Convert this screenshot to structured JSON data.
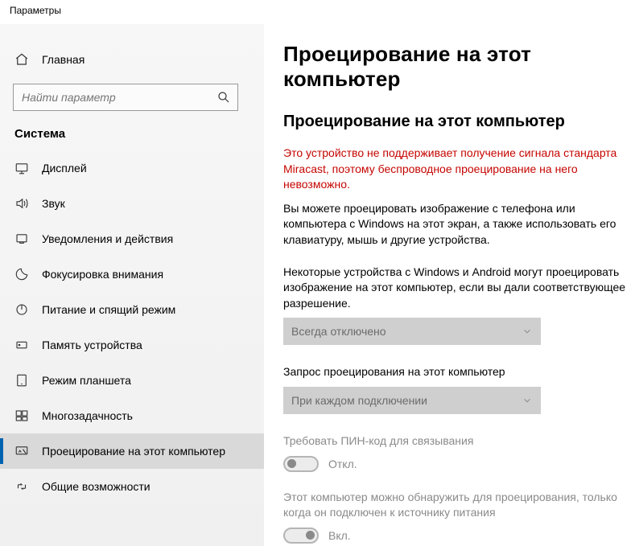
{
  "window": {
    "title": "Параметры"
  },
  "sidebar": {
    "home": "Главная",
    "search_placeholder": "Найти параметр",
    "section": "Система",
    "items": [
      {
        "key": "display",
        "label": "Дисплей"
      },
      {
        "key": "sound",
        "label": "Звук"
      },
      {
        "key": "notify",
        "label": "Уведомления и действия"
      },
      {
        "key": "focus",
        "label": "Фокусировка внимания"
      },
      {
        "key": "power",
        "label": "Питание и спящий режим"
      },
      {
        "key": "storage",
        "label": "Память устройства"
      },
      {
        "key": "tablet",
        "label": "Режим планшета"
      },
      {
        "key": "multitask",
        "label": "Многозадачность"
      },
      {
        "key": "project",
        "label": "Проецирование на этот компьютер",
        "selected": true
      },
      {
        "key": "shared",
        "label": "Общие возможности"
      }
    ]
  },
  "main": {
    "title": "Проецирование на этот компьютер",
    "subtitle": "Проецирование на этот компьютер",
    "warning": "Это устройство не поддерживает получение сигнала стандарта Miracast, поэтому беспроводное проецирование на него невозможно.",
    "desc": "Вы можете проецировать изображение с телефона или компьютера с Windows на этот экран, а также использовать его клавиатуру, мышь и другие устройства.",
    "setting1": {
      "label": "Некоторые устройства с Windows и Android могут проецировать изображение на этот компьютер, если вы дали соответствующее разрешение.",
      "value": "Всегда отключено"
    },
    "setting2": {
      "label": "Запрос проецирования на этот компьютер",
      "value": "При каждом подключении"
    },
    "setting3": {
      "label": "Требовать ПИН-код для связывания",
      "state": "Откл."
    },
    "setting4": {
      "label": "Этот компьютер можно обнаружить для проецирования, только когда он подключен к источнику питания",
      "state": "Вкл."
    }
  }
}
